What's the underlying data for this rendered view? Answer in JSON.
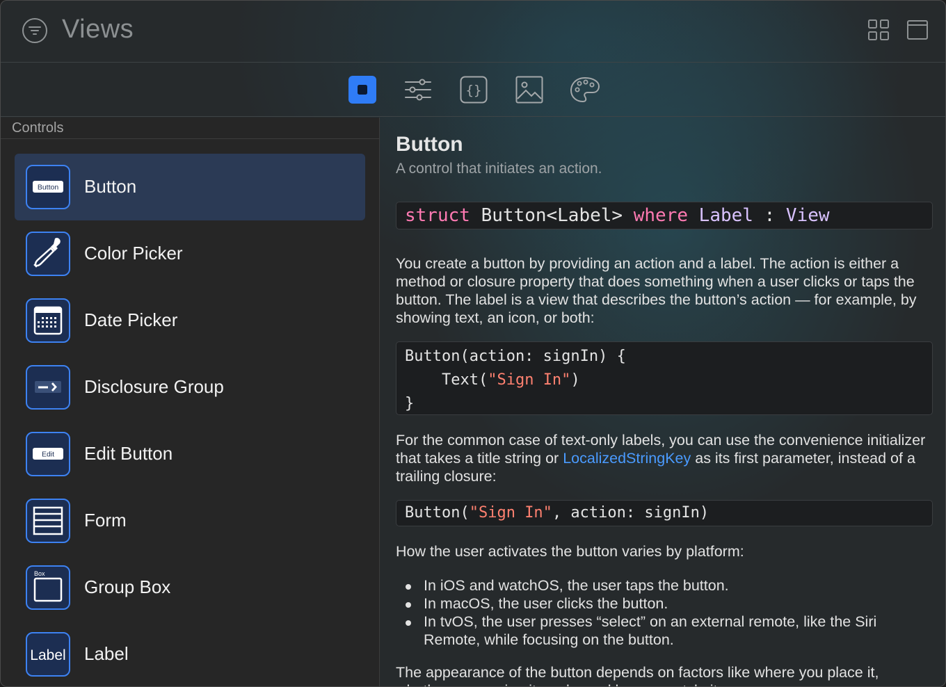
{
  "window": {
    "title": "Views"
  },
  "toolbar": {
    "items": [
      {
        "name": "views-tab-icon",
        "active": true
      },
      {
        "name": "modifiers-tab-icon",
        "active": false
      },
      {
        "name": "code-tab-icon",
        "active": false
      },
      {
        "name": "image-tab-icon",
        "active": false
      },
      {
        "name": "palette-tab-icon",
        "active": false
      }
    ]
  },
  "sidebar": {
    "section": "Controls",
    "items": [
      {
        "label": "Button",
        "icon": "button-icon",
        "icon_text": "Button",
        "selected": true
      },
      {
        "label": "Color Picker",
        "icon": "eyedropper-icon"
      },
      {
        "label": "Date Picker",
        "icon": "calendar-icon"
      },
      {
        "label": "Disclosure Group",
        "icon": "disclosure-icon"
      },
      {
        "label": "Edit Button",
        "icon": "edit-button-icon",
        "icon_text": "Edit"
      },
      {
        "label": "Form",
        "icon": "form-icon"
      },
      {
        "label": "Group Box",
        "icon": "group-box-icon",
        "icon_text": "Box"
      },
      {
        "label": "Label",
        "icon": "label-icon",
        "icon_text": "Label"
      }
    ]
  },
  "detail": {
    "title": "Button",
    "subtitle": "A control that initiates an action.",
    "declaration": {
      "kw1": "struct",
      "name": "Button<Label>",
      "kw2": "where",
      "generic": "Label",
      "sep": ":",
      "proto": "View"
    },
    "para1": "You create a button by providing an action and a label. The action is either a method or closure property that does something when a user clicks or taps the button. The label is a view that describes the button’s action — for example, by showing text, an icon, or both:",
    "code1": {
      "line1": "Button(action: signIn) {",
      "line2_pre": "    Text(",
      "line2_str": "\"Sign In\"",
      "line2_post": ")",
      "line3": "}"
    },
    "para2_a": "For the common case of text-only labels, you can use the convenience initializer that takes a title string or ",
    "para2_link": "LocalizedStringKey",
    "para2_b": " as its first parameter, instead of a trailing closure:",
    "code2": {
      "pre": "Button(",
      "str": "\"Sign In\"",
      "post": ", action: signIn)"
    },
    "para3": "How the user activates the button varies by platform:",
    "bullets": [
      "In iOS and watchOS, the user taps the button.",
      "In macOS, the user clicks the button.",
      "In tvOS, the user presses “select” on an external remote, like the Siri Remote, while focusing on the button."
    ],
    "para4": "The appearance of the button depends on factors like where you place it, whether you assign it a role, and how you style it."
  },
  "colors": {
    "accent": "#2f7cf6",
    "keyword": "#ff7ab2",
    "type": "#d9c2ff",
    "string": "#ff8170",
    "link": "#4a9bff",
    "selection": "#2b3a55"
  }
}
